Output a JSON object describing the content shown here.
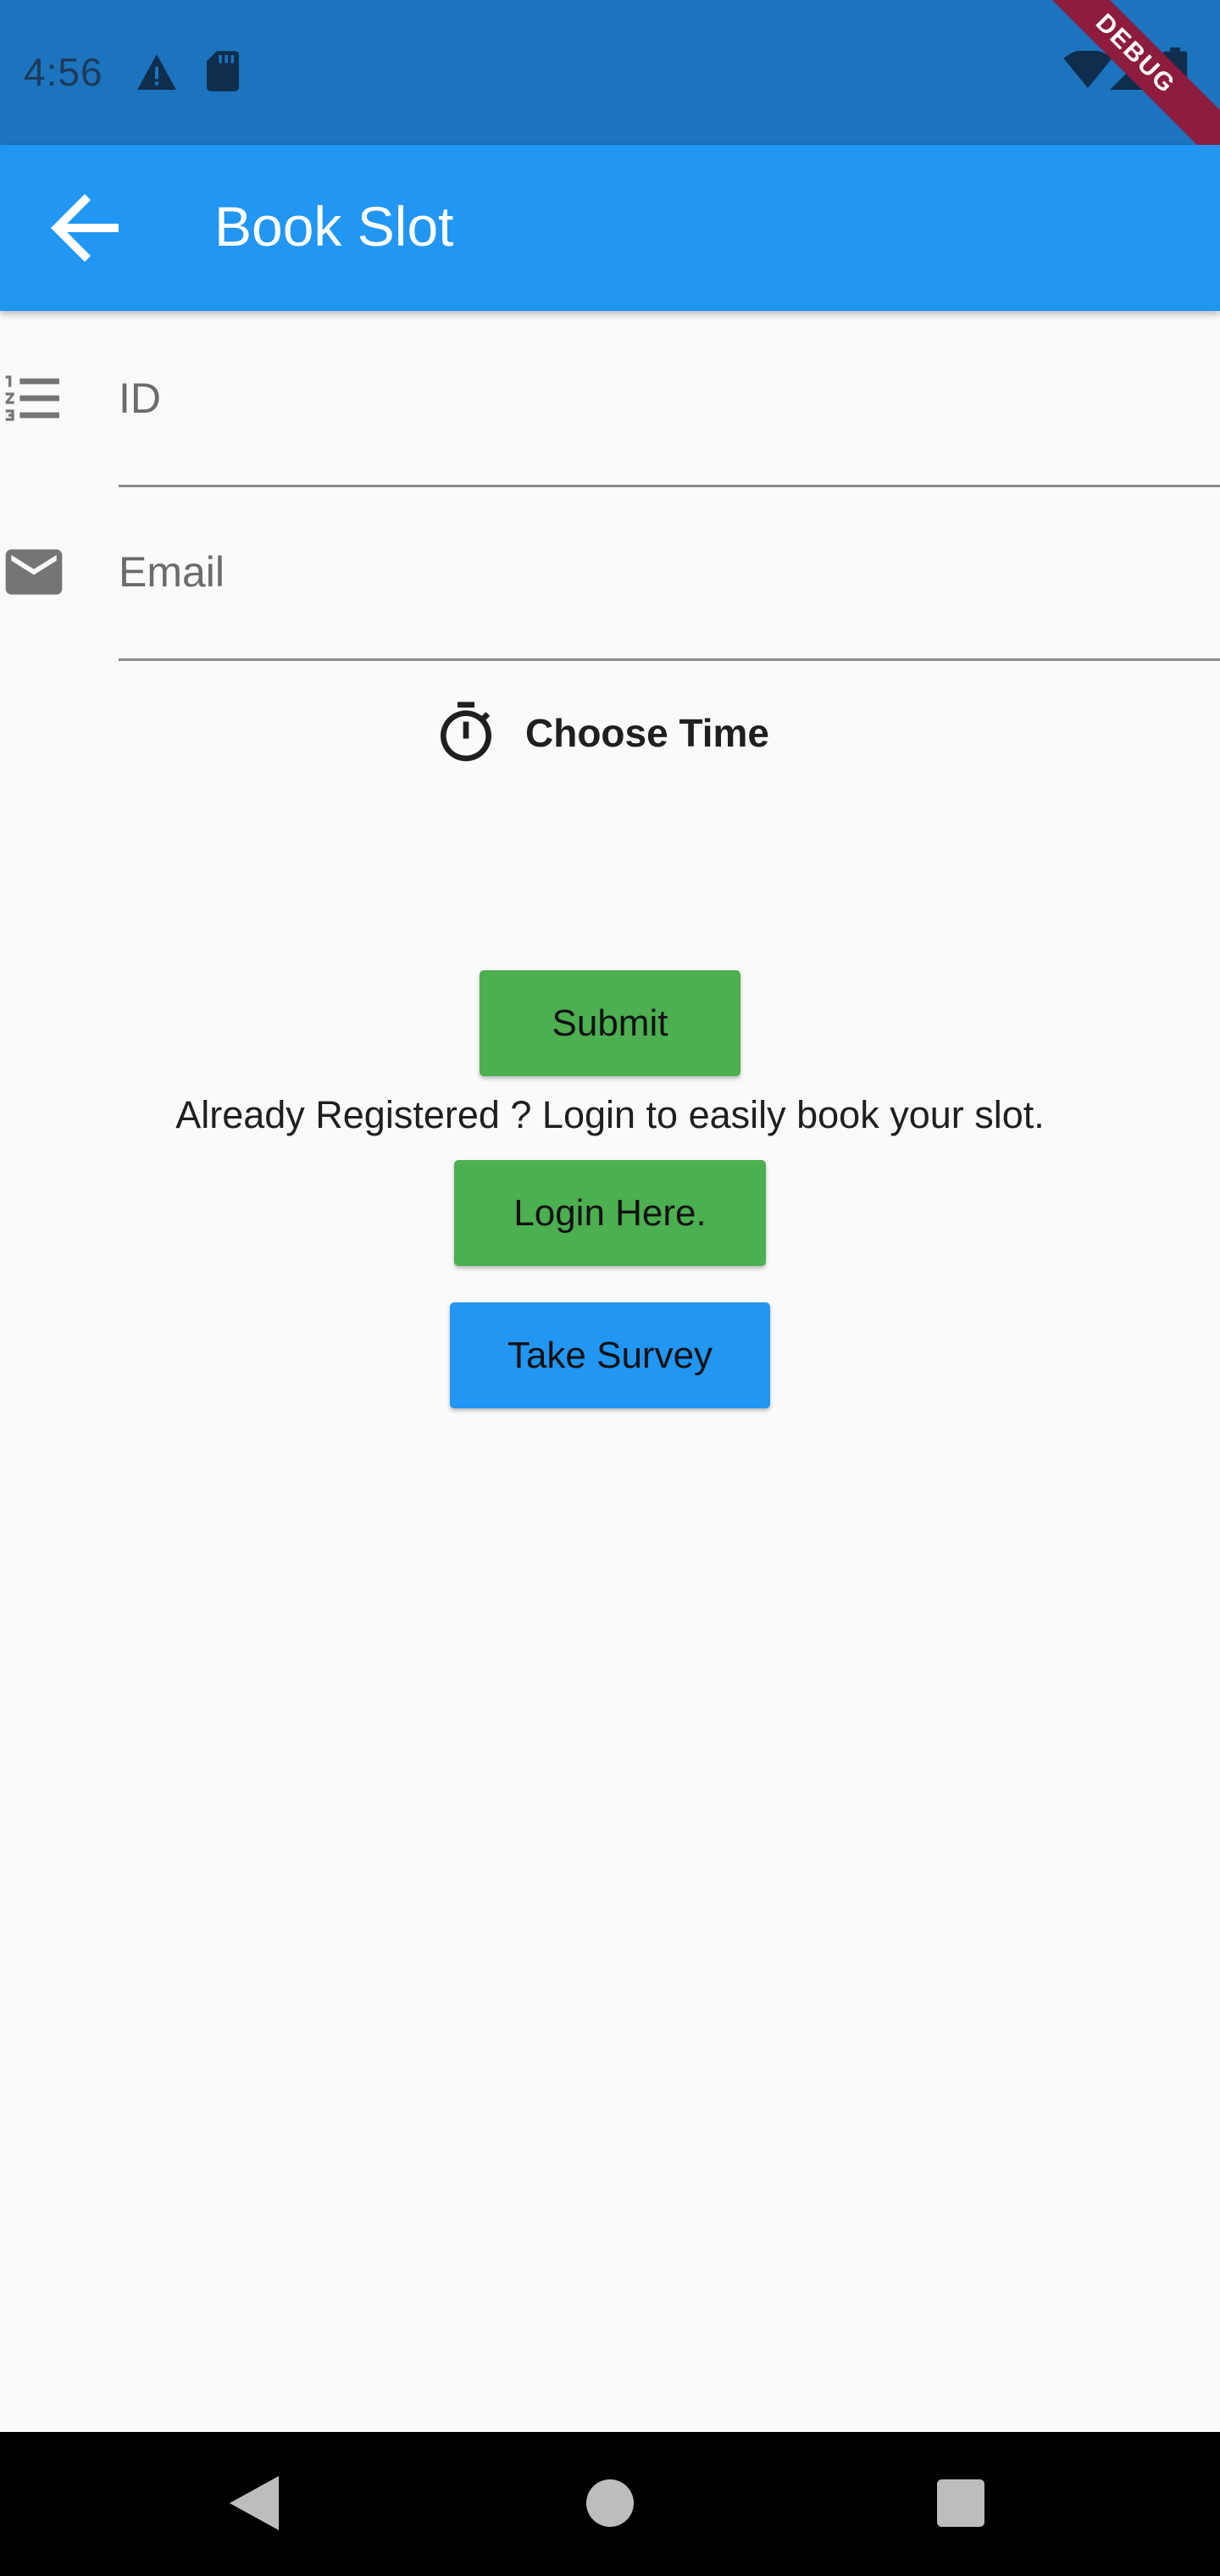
{
  "status_bar": {
    "time": "4:56",
    "icons": [
      "warning-icon",
      "sd-card-icon",
      "wifi-icon",
      "signal-icon",
      "battery-icon"
    ],
    "debug_banner": "DEBUG",
    "background": "#1b74bd"
  },
  "app_bar": {
    "title": "Book Slot",
    "back_icon": "arrow-back-icon",
    "background": "#2196f3"
  },
  "form": {
    "id_field": {
      "icon": "format-list-numbered-icon",
      "placeholder": "ID",
      "value": ""
    },
    "email_field": {
      "icon": "email-icon",
      "placeholder": "Email",
      "value": ""
    },
    "choose_time": {
      "icon": "timer-icon",
      "label": "Choose Time"
    }
  },
  "actions": {
    "submit_label": "Submit",
    "helper_text": "Already Registered ? Login to easily book your slot.",
    "login_label": "Login Here.",
    "survey_label": "Take Survey",
    "green": "#4caf50",
    "blue": "#2196f3"
  },
  "nav_bar": {
    "icons": [
      "back-triangle-icon",
      "home-circle-icon",
      "recents-square-icon"
    ]
  }
}
